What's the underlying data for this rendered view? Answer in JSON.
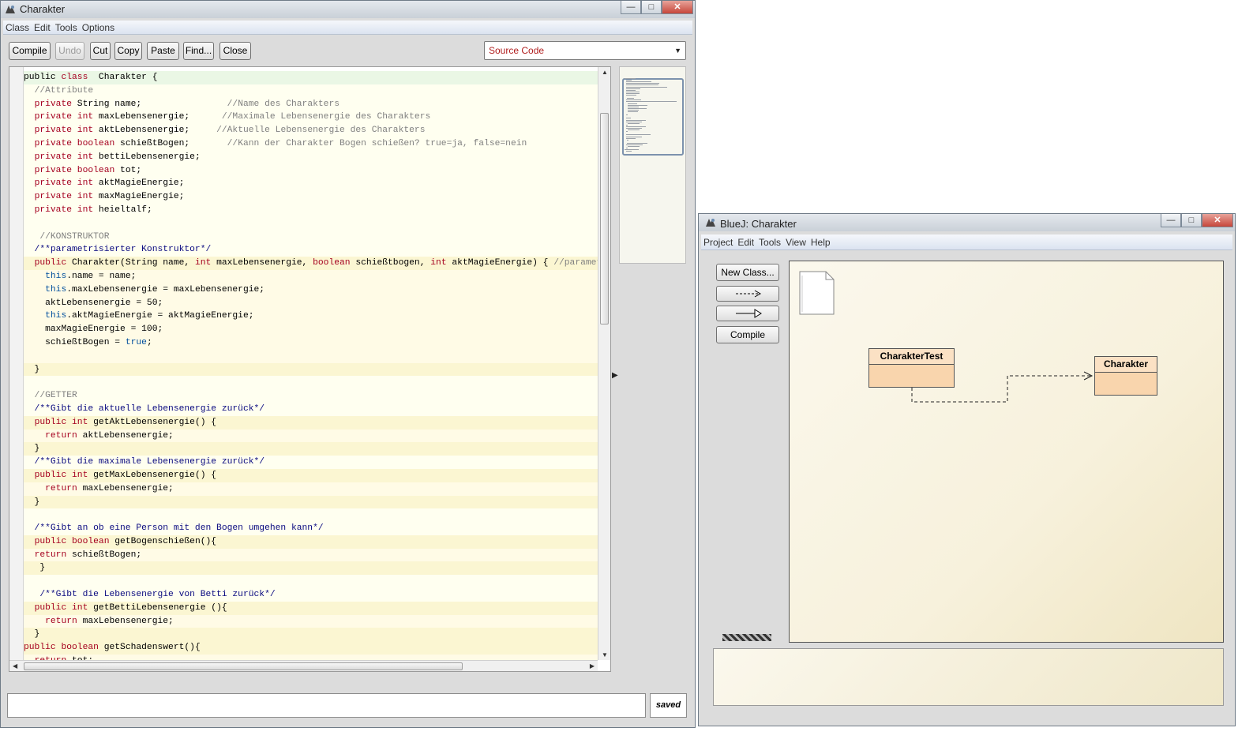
{
  "editor": {
    "title": "Charakter",
    "menu": [
      "Class",
      "Edit",
      "Tools",
      "Options"
    ],
    "toolbar": {
      "compile": "Compile",
      "undo": "Undo",
      "cut": "Cut",
      "copy": "Copy",
      "paste": "Paste",
      "find": "Find...",
      "close": "Close"
    },
    "view_select": "Source Code",
    "status": "saved",
    "message": ""
  },
  "code": [
    {
      "s": "cls",
      "t": [
        [
          "",
          "public "
        ],
        [
          "kw",
          "class"
        ],
        [
          "",
          "  Charakter {"
        ]
      ]
    },
    {
      "s": "bg",
      "t": [
        [
          "cm",
          "  //Attribute"
        ]
      ]
    },
    {
      "s": "bg",
      "t": [
        [
          "",
          "  "
        ],
        [
          "kw",
          "private"
        ],
        [
          "",
          " String name;                "
        ],
        [
          "cm",
          "//Name des Charakters"
        ]
      ]
    },
    {
      "s": "bg",
      "t": [
        [
          "",
          "  "
        ],
        [
          "kw",
          "private"
        ],
        [
          "",
          ""
        ],
        [
          "kw",
          " int"
        ],
        [
          "",
          " maxLebensenergie;      "
        ],
        [
          "cm",
          "//Maximale Lebensenergie des Charakters"
        ]
      ]
    },
    {
      "s": "bg",
      "t": [
        [
          "",
          "  "
        ],
        [
          "kw",
          "private"
        ],
        [
          "kw",
          " int"
        ],
        [
          "",
          " aktLebensenergie;     "
        ],
        [
          "cm",
          "//Aktuelle Lebensenergie des Charakters"
        ]
      ]
    },
    {
      "s": "bg",
      "t": [
        [
          "",
          "  "
        ],
        [
          "kw",
          "private"
        ],
        [
          "kw",
          " boolean"
        ],
        [
          "",
          " schießtBogen;       "
        ],
        [
          "cm",
          "//Kann der Charakter Bogen schießen? true=ja, false=nein"
        ]
      ]
    },
    {
      "s": "bg",
      "t": [
        [
          "",
          "  "
        ],
        [
          "kw",
          "private"
        ],
        [
          "kw",
          " int"
        ],
        [
          "",
          " bettiLebensenergie;"
        ]
      ]
    },
    {
      "s": "bg",
      "t": [
        [
          "",
          "  "
        ],
        [
          "kw",
          "private"
        ],
        [
          "kw",
          " boolean"
        ],
        [
          "",
          " tot;"
        ]
      ]
    },
    {
      "s": "bg",
      "t": [
        [
          "",
          "  "
        ],
        [
          "kw",
          "private"
        ],
        [
          "kw",
          " int"
        ],
        [
          "",
          " aktMagieEnergie;"
        ]
      ]
    },
    {
      "s": "bg",
      "t": [
        [
          "",
          "  "
        ],
        [
          "kw",
          "private"
        ],
        [
          "kw",
          " int"
        ],
        [
          "",
          " maxMagieEnergie;"
        ]
      ]
    },
    {
      "s": "bg",
      "t": [
        [
          "",
          "  "
        ],
        [
          "kw",
          "private"
        ],
        [
          "kw",
          " int"
        ],
        [
          "",
          " heieltalf;"
        ]
      ]
    },
    {
      "s": "bg",
      "t": [
        [
          "",
          ""
        ]
      ]
    },
    {
      "s": "bg",
      "t": [
        [
          "cm",
          "   //KONSTRUKTOR"
        ]
      ]
    },
    {
      "s": "bg",
      "t": [
        [
          "jd",
          "  /**parametrisierter Konstruktor*/"
        ]
      ]
    },
    {
      "s": "m",
      "t": [
        [
          "",
          "  "
        ],
        [
          "kw",
          "public"
        ],
        [
          "",
          " Charakter(String name, "
        ],
        [
          "kw",
          "int"
        ],
        [
          "",
          " maxLebensenergie, "
        ],
        [
          "kw",
          "boolean"
        ],
        [
          "",
          " schießtbogen, "
        ],
        [
          "kw",
          "int"
        ],
        [
          "",
          " aktMagieEnergie) { "
        ],
        [
          "cm",
          "//parametrisierter"
        ]
      ]
    },
    {
      "s": "mb",
      "t": [
        [
          "",
          "    "
        ],
        [
          "th",
          "this"
        ],
        [
          "",
          ".name = name;"
        ]
      ]
    },
    {
      "s": "mb",
      "t": [
        [
          "",
          "    "
        ],
        [
          "th",
          "this"
        ],
        [
          "",
          ".maxLebensenergie = maxLebensenergie;"
        ]
      ]
    },
    {
      "s": "mb",
      "t": [
        [
          "",
          "    aktLebensenergie = 50;"
        ]
      ]
    },
    {
      "s": "mb",
      "t": [
        [
          "",
          "    "
        ],
        [
          "th",
          "this"
        ],
        [
          "",
          ".aktMagieEnergie = aktMagieEnergie;"
        ]
      ]
    },
    {
      "s": "mb",
      "t": [
        [
          "",
          "    maxMagieEnergie = 100;"
        ]
      ]
    },
    {
      "s": "mb",
      "t": [
        [
          "",
          "    schießtBogen = "
        ],
        [
          "th",
          "true"
        ],
        [
          "",
          ";"
        ]
      ]
    },
    {
      "s": "mb",
      "t": [
        [
          "",
          ""
        ]
      ]
    },
    {
      "s": "m",
      "t": [
        [
          "",
          "  }"
        ]
      ]
    },
    {
      "s": "bg",
      "t": [
        [
          "",
          ""
        ]
      ]
    },
    {
      "s": "bg",
      "t": [
        [
          "cm",
          "  //GETTER"
        ]
      ]
    },
    {
      "s": "bg",
      "t": [
        [
          "jd",
          "  /**Gibt die aktuelle Lebensenergie zurück*/"
        ]
      ]
    },
    {
      "s": "m",
      "t": [
        [
          "",
          "  "
        ],
        [
          "kw",
          "public"
        ],
        [
          "kw",
          " int"
        ],
        [
          "",
          " getAktLebensenergie() {"
        ]
      ]
    },
    {
      "s": "mb",
      "t": [
        [
          "",
          "    "
        ],
        [
          "kw",
          "return"
        ],
        [
          "",
          " aktLebensenergie;"
        ]
      ]
    },
    {
      "s": "m",
      "t": [
        [
          "",
          "  }"
        ]
      ]
    },
    {
      "s": "bg",
      "t": [
        [
          "jd",
          "  /**Gibt die maximale Lebensenergie zurück*/"
        ]
      ]
    },
    {
      "s": "m",
      "t": [
        [
          "",
          "  "
        ],
        [
          "kw",
          "public"
        ],
        [
          "kw",
          " int"
        ],
        [
          "",
          " getMaxLebensenergie() {"
        ]
      ]
    },
    {
      "s": "mb",
      "t": [
        [
          "",
          "    "
        ],
        [
          "kw",
          "return"
        ],
        [
          "",
          " maxLebensenergie;"
        ]
      ]
    },
    {
      "s": "m",
      "t": [
        [
          "",
          "  }"
        ]
      ]
    },
    {
      "s": "bg",
      "t": [
        [
          "",
          ""
        ]
      ]
    },
    {
      "s": "bg",
      "t": [
        [
          "jd",
          "  /**Gibt an ob eine Person mit den Bogen umgehen kann*/"
        ]
      ]
    },
    {
      "s": "m",
      "t": [
        [
          "",
          "  "
        ],
        [
          "kw",
          "public"
        ],
        [
          "kw",
          " boolean"
        ],
        [
          "",
          " getBogenschießen(){"
        ]
      ]
    },
    {
      "s": "mb",
      "t": [
        [
          "",
          "  "
        ],
        [
          "kw",
          "return"
        ],
        [
          "",
          " schießtBogen;"
        ]
      ]
    },
    {
      "s": "m",
      "t": [
        [
          "",
          "   }"
        ]
      ]
    },
    {
      "s": "bg",
      "t": [
        [
          "",
          ""
        ]
      ]
    },
    {
      "s": "bg",
      "t": [
        [
          "jd",
          "   /**Gibt die Lebensenergie von Betti zurück*/"
        ]
      ]
    },
    {
      "s": "m",
      "t": [
        [
          "",
          "  "
        ],
        [
          "kw",
          "public"
        ],
        [
          "kw",
          " int"
        ],
        [
          "",
          " getBettiLebensenergie (){"
        ]
      ]
    },
    {
      "s": "mb",
      "t": [
        [
          "",
          "    "
        ],
        [
          "kw",
          "return"
        ],
        [
          "",
          " maxLebensenergie;"
        ]
      ]
    },
    {
      "s": "m",
      "t": [
        [
          "",
          "  }"
        ]
      ]
    },
    {
      "s": "m",
      "t": [
        [
          "",
          ""
        ],
        [
          "kw",
          "public"
        ],
        [
          "kw",
          " boolean"
        ],
        [
          "",
          " getSchadenswert(){"
        ]
      ]
    },
    {
      "s": "mb",
      "t": [
        [
          "",
          "  "
        ],
        [
          "kw",
          "return"
        ],
        [
          "",
          " tot;"
        ]
      ]
    }
  ],
  "bluej": {
    "title": "BlueJ:  Charakter",
    "menu": [
      "Project",
      "Edit",
      "Tools",
      "View",
      "Help"
    ],
    "buttons": {
      "new_class": "New Class...",
      "dep_arrow": "--->",
      "inh_arrow": "──▷",
      "compile": "Compile"
    },
    "classes": [
      {
        "name": "CharakterTest"
      },
      {
        "name": "Charakter"
      }
    ],
    "output": ""
  },
  "colors": {
    "keyword": "#a5001f",
    "comment": "#808080",
    "javadoc": "#0a0a80",
    "class_fill": "#f9d5ad"
  }
}
